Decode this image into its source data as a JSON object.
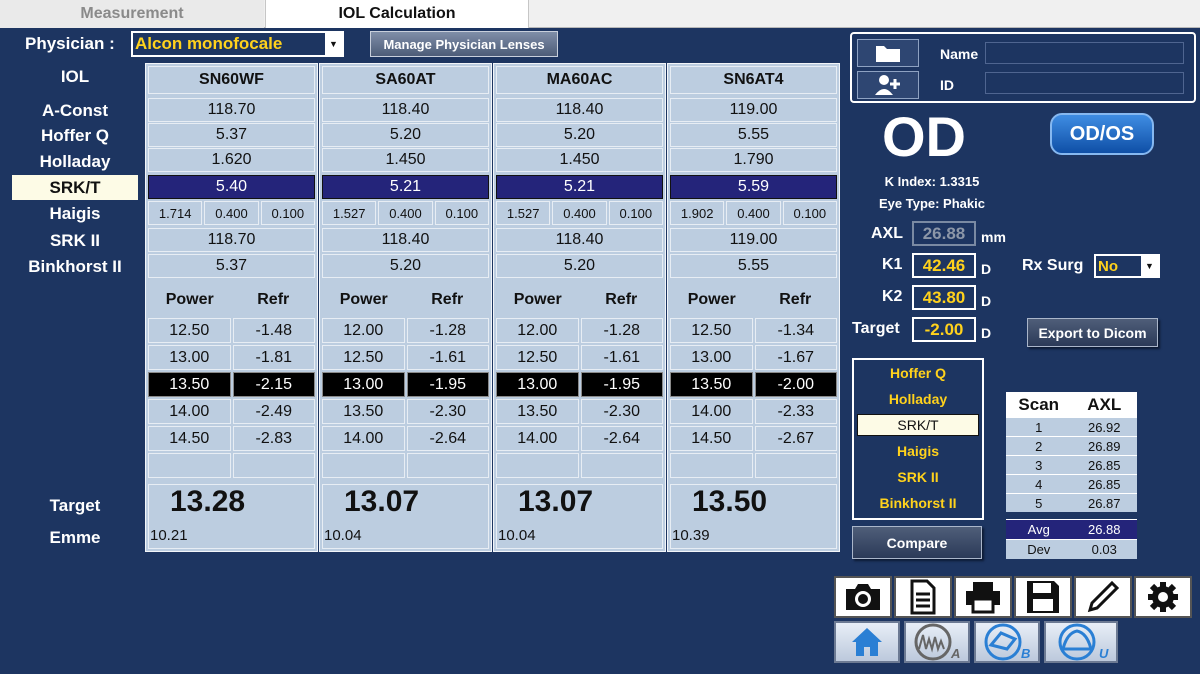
{
  "tabs": {
    "measurement": "Measurement",
    "iol_calc": "IOL Calculation"
  },
  "physician": {
    "label": "Physician :",
    "value": "Alcon monofocale",
    "manage_button": "Manage Physician Lenses"
  },
  "row_labels": {
    "iol": "IOL",
    "a_const": "A-Const",
    "hoffer_q": "Hoffer Q",
    "holladay": "Holladay",
    "srkt": "SRK/T",
    "haigis": "Haigis",
    "srk2": "SRK II",
    "binkhorst": "Binkhorst II",
    "target": "Target",
    "emme": "Emme"
  },
  "power_header": {
    "power": "Power",
    "refr": "Refr"
  },
  "lenses": [
    {
      "name": "SN60WF",
      "a_const": "118.70",
      "hoffer_q": "5.37",
      "holladay": "1.620",
      "srkt": "5.40",
      "haigis": [
        "1.714",
        "0.400",
        "0.100"
      ],
      "srk2": "118.70",
      "binkhorst": "5.37",
      "rows": [
        [
          "12.50",
          "-1.48"
        ],
        [
          "13.00",
          "-1.81"
        ],
        [
          "13.50",
          "-2.15"
        ],
        [
          "14.00",
          "-2.49"
        ],
        [
          "14.50",
          "-2.83"
        ]
      ],
      "target": "13.28",
      "emme": "10.21"
    },
    {
      "name": "SA60AT",
      "a_const": "118.40",
      "hoffer_q": "5.20",
      "holladay": "1.450",
      "srkt": "5.21",
      "haigis": [
        "1.527",
        "0.400",
        "0.100"
      ],
      "srk2": "118.40",
      "binkhorst": "5.20",
      "rows": [
        [
          "12.00",
          "-1.28"
        ],
        [
          "12.50",
          "-1.61"
        ],
        [
          "13.00",
          "-1.95"
        ],
        [
          "13.50",
          "-2.30"
        ],
        [
          "14.00",
          "-2.64"
        ]
      ],
      "target": "13.07",
      "emme": "10.04"
    },
    {
      "name": "MA60AC",
      "a_const": "118.40",
      "hoffer_q": "5.20",
      "holladay": "1.450",
      "srkt": "5.21",
      "haigis": [
        "1.527",
        "0.400",
        "0.100"
      ],
      "srk2": "118.40",
      "binkhorst": "5.20",
      "rows": [
        [
          "12.00",
          "-1.28"
        ],
        [
          "12.50",
          "-1.61"
        ],
        [
          "13.00",
          "-1.95"
        ],
        [
          "13.50",
          "-2.30"
        ],
        [
          "14.00",
          "-2.64"
        ]
      ],
      "target": "13.07",
      "emme": "10.04"
    },
    {
      "name": "SN6AT4",
      "a_const": "119.00",
      "hoffer_q": "5.55",
      "holladay": "1.790",
      "srkt": "5.59",
      "haigis": [
        "1.902",
        "0.400",
        "0.100"
      ],
      "srk2": "119.00",
      "binkhorst": "5.55",
      "rows": [
        [
          "12.50",
          "-1.34"
        ],
        [
          "13.00",
          "-1.67"
        ],
        [
          "13.50",
          "-2.00"
        ],
        [
          "14.00",
          "-2.33"
        ],
        [
          "14.50",
          "-2.67"
        ]
      ],
      "target": "13.50",
      "emme": "10.39"
    }
  ],
  "patient": {
    "name_label": "Name",
    "id_label": "ID",
    "name_value": "",
    "id_value": ""
  },
  "eye": {
    "side": "OD",
    "toggle": "OD/OS",
    "k_index": "K Index: 1.3315",
    "eye_type": "Eye Type: Phakic"
  },
  "measures": {
    "axl_label": "AXL",
    "axl": "26.88",
    "axl_unit": "mm",
    "k1_label": "K1",
    "k1": "42.46",
    "k2_label": "K2",
    "k2": "43.80",
    "target_label": "Target",
    "target": "-2.00",
    "d_unit": "D"
  },
  "rx_surg": {
    "label": "Rx Surg",
    "value": "No"
  },
  "export_button": "Export to Dicom",
  "formulas": [
    "Hoffer Q",
    "Holladay",
    "SRK/T",
    "Haigis",
    "SRK II",
    "Binkhorst II"
  ],
  "compare_button": "Compare",
  "scan_table": {
    "headers": [
      "Scan",
      "AXL"
    ],
    "rows": [
      [
        "1",
        "26.92"
      ],
      [
        "2",
        "26.89"
      ],
      [
        "3",
        "26.85"
      ],
      [
        "4",
        "26.85"
      ],
      [
        "5",
        "26.87"
      ]
    ],
    "avg_label": "Avg",
    "avg": "26.88",
    "dev_label": "Dev",
    "dev": "0.03"
  },
  "toolbar_icons": [
    "camera-icon",
    "document-icon",
    "printer-icon",
    "save-icon",
    "pencil-icon",
    "gear-icon"
  ],
  "mode_icons": [
    "home-icon",
    "a-scan-icon",
    "b-scan-icon",
    "u-scan-icon"
  ],
  "mode_letters": {
    "a": "A",
    "b": "B",
    "u": "U"
  }
}
